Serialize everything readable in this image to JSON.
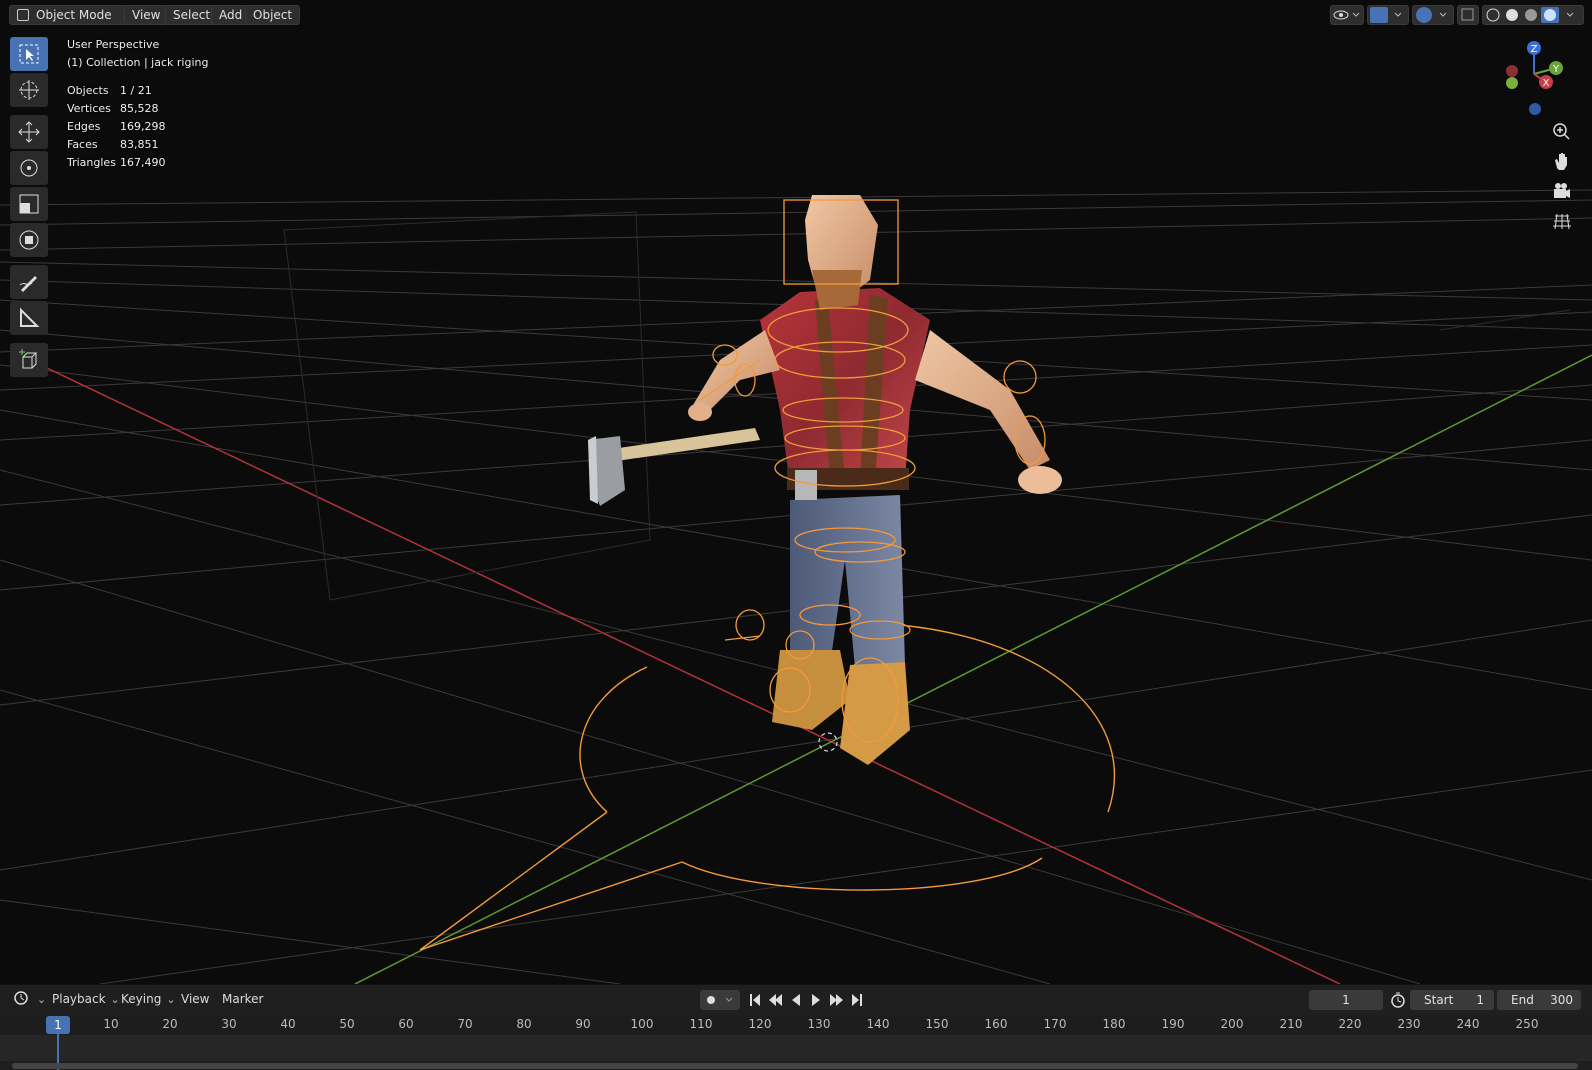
{
  "header": {
    "mode_label": "Object Mode",
    "menu": [
      "View",
      "Select",
      "Add",
      "Object"
    ]
  },
  "overlay": {
    "perspective": "User Perspective",
    "collection": "(1) Collection | jack riging"
  },
  "stats": [
    {
      "label": "Objects",
      "value": "1 / 21"
    },
    {
      "label": "Vertices",
      "value": "85,528"
    },
    {
      "label": "Edges",
      "value": "169,298"
    },
    {
      "label": "Faces",
      "value": "83,851"
    },
    {
      "label": "Triangles",
      "value": "167,490"
    }
  ],
  "gizmo": {
    "z": "Z",
    "y": "Y",
    "x": "X"
  },
  "tools": [
    "select-box-icon",
    "cursor-icon",
    "move-icon",
    "rotate-icon",
    "scale-icon",
    "transform-icon",
    "annotate-icon",
    "measure-icon",
    "add-cube-icon"
  ],
  "timeline": {
    "menus": [
      "Playback",
      "Keying",
      "View",
      "Marker"
    ],
    "current_frame": "1",
    "start_label": "Start",
    "start_value": "1",
    "end_label": "End",
    "end_value": "300",
    "playhead_frame": "1",
    "ruler": [
      "10",
      "20",
      "30",
      "40",
      "50",
      "60",
      "70",
      "80",
      "90",
      "100",
      "110",
      "120",
      "130",
      "140",
      "150",
      "160",
      "170",
      "180",
      "190",
      "200",
      "210",
      "220",
      "230",
      "240",
      "250"
    ]
  },
  "colors": {
    "accent": "#4772b3",
    "rig": "#f39a3a",
    "x_axis": "#c53e4a",
    "y_axis": "#6aa33b"
  }
}
